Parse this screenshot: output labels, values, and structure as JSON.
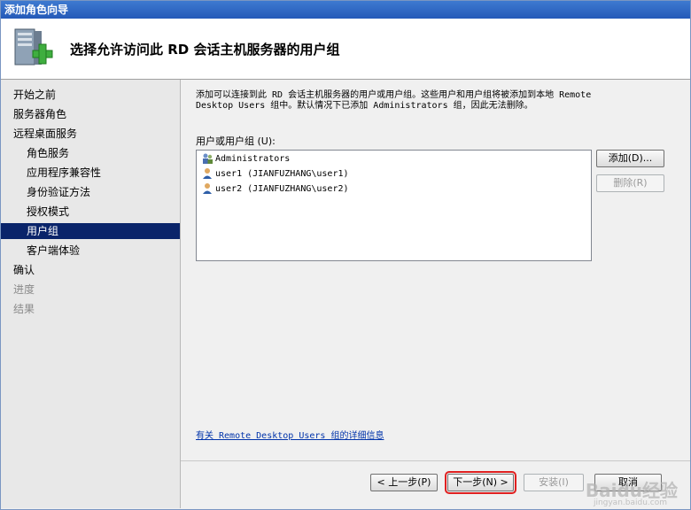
{
  "window": {
    "title": "添加角色向导"
  },
  "header": {
    "title": "选择允许访问此 RD 会话主机服务器的用户组",
    "icon": "server-add-icon"
  },
  "sidebar": {
    "items": [
      {
        "label": "开始之前",
        "state": "normal",
        "indent": false
      },
      {
        "label": "服务器角色",
        "state": "normal",
        "indent": false
      },
      {
        "label": "远程桌面服务",
        "state": "normal",
        "indent": false
      },
      {
        "label": "角色服务",
        "state": "normal",
        "indent": true
      },
      {
        "label": "应用程序兼容性",
        "state": "normal",
        "indent": true
      },
      {
        "label": "身份验证方法",
        "state": "normal",
        "indent": true
      },
      {
        "label": "授权模式",
        "state": "normal",
        "indent": true
      },
      {
        "label": "用户组",
        "state": "active",
        "indent": true
      },
      {
        "label": "客户端体验",
        "state": "normal",
        "indent": true
      },
      {
        "label": "确认",
        "state": "normal",
        "indent": false
      },
      {
        "label": "进度",
        "state": "disabled",
        "indent": false
      },
      {
        "label": "结果",
        "state": "disabled",
        "indent": false
      }
    ]
  },
  "main": {
    "description_line1": "添加可以连接到此 RD 会话主机服务器的用户或用户组。这些用户和用户组将被添加到本地 Remote",
    "description_line2": "Desktop Users 组中。默认情况下已添加 Administrators 组，因此无法删除。",
    "list_label": "用户或用户组 (U):",
    "users": [
      {
        "name": "Administrators",
        "icon": "group-icon"
      },
      {
        "name": "user1 (JIANFUZHANG\\user1)",
        "icon": "user-icon"
      },
      {
        "name": "user2 (JIANFUZHANG\\user2)",
        "icon": "user-icon"
      }
    ],
    "add_button": "添加(D)...",
    "remove_button": "删除(R)",
    "info_link": "有关 Remote Desktop Users 组的详细信息"
  },
  "footer": {
    "back": "< 上一步(P)",
    "next": "下一步(N) >",
    "install": "安装(I)",
    "cancel": "取消"
  },
  "watermark": {
    "brand": "Baidu经验",
    "url": "jingyan.baidu.com"
  },
  "colors": {
    "title_bar": "#2d62c0",
    "active_item": "#0a246a",
    "highlight": "#e02020",
    "link": "#0033aa"
  }
}
